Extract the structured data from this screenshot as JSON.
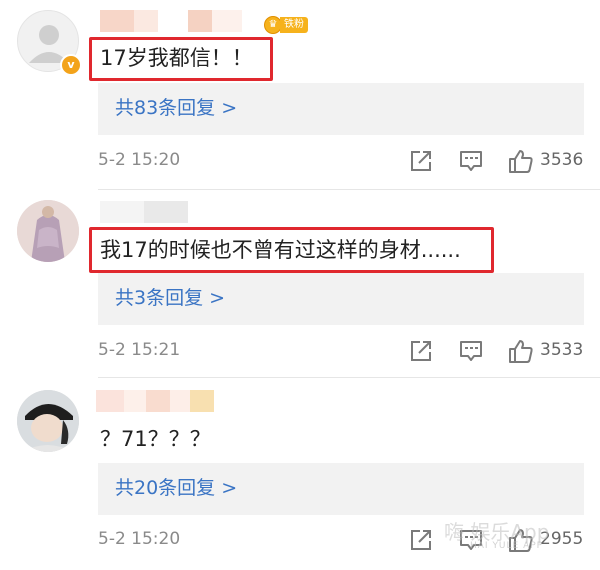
{
  "colors": {
    "highlight": "#e0282e",
    "reply_link": "#3a74c4",
    "meta_text": "#8a8a8a",
    "badge": "#f6b21c"
  },
  "comments": [
    {
      "avatar": "default-user-avatar",
      "fan_badge": "铁粉",
      "verified_badge": "v",
      "text": "17岁我都信！！",
      "reply_link": "共83条回复 >",
      "timestamp": "5-2 15:20",
      "likes": "3536"
    },
    {
      "avatar": "user-photo-avatar",
      "text": "我17的时候也不曾有过这样的身材......",
      "reply_link": "共3条回复 >",
      "timestamp": "5-2 15:21",
      "likes": "3533"
    },
    {
      "avatar": "user-photo-avatar",
      "text": "？71？？？",
      "reply_link": "共20条回复 >",
      "timestamp": "5-2 15:20",
      "likes": "2955"
    }
  ],
  "watermark": {
    "text": "嗨 娱乐App",
    "sub": "HAI YULE APP"
  }
}
